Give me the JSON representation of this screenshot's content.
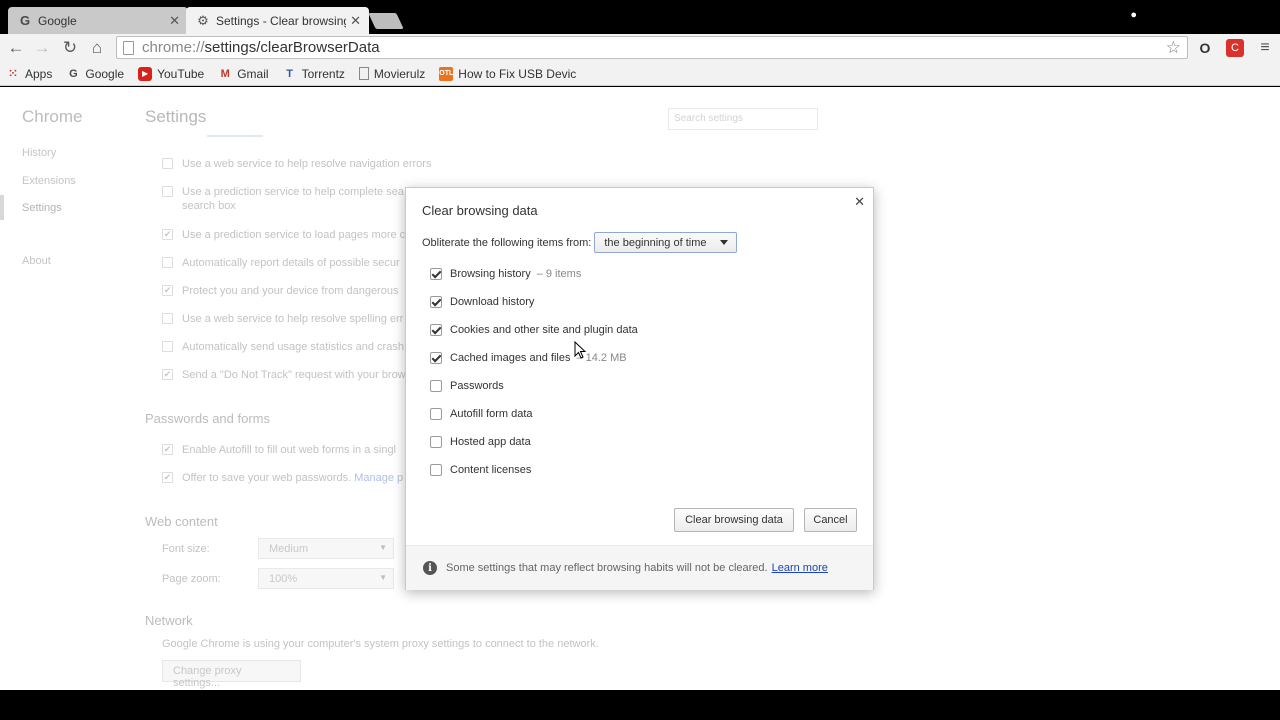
{
  "tabs": [
    {
      "title": "Google",
      "icon": "google-g-icon"
    },
    {
      "title": "Settings - Clear browsing",
      "icon": "gear-icon"
    }
  ],
  "omnibox": {
    "scheme": "chrome://",
    "path": "settings/clearBrowserData"
  },
  "bookmarks": [
    {
      "label": "Apps",
      "icon": "apps-grid-icon"
    },
    {
      "label": "Google",
      "icon": "google-g-icon"
    },
    {
      "label": "YouTube",
      "icon": "youtube-icon"
    },
    {
      "label": "Gmail",
      "icon": "gmail-icon"
    },
    {
      "label": "Torrentz",
      "icon": "torrentz-icon"
    },
    {
      "label": "Movierulz",
      "icon": "page-icon"
    },
    {
      "label": "How to Fix USB Devic",
      "icon": "otl-icon"
    }
  ],
  "settings": {
    "brand": "Chrome",
    "title": "Settings",
    "search_placeholder": "Search settings",
    "side_nav": [
      "History",
      "Extensions",
      "Settings",
      "About"
    ],
    "privacy_options": [
      {
        "label": "Use a web service to help resolve navigation errors",
        "checked": false
      },
      {
        "label": "Use a prediction service to help complete sea",
        "label2": "search box",
        "checked": false
      },
      {
        "label": "Use a prediction service to load pages more c",
        "checked": true
      },
      {
        "label": "Automatically report details of possible secur",
        "checked": false
      },
      {
        "label": "Protect you and your device from dangerous",
        "checked": true
      },
      {
        "label": "Use a web service to help resolve spelling err",
        "checked": false
      },
      {
        "label": "Automatically send usage statistics and crash",
        "checked": false
      },
      {
        "label": "Send a \"Do Not Track\" request with your brow",
        "checked": true
      }
    ],
    "passwords_head": "Passwords and forms",
    "passwords_options": [
      {
        "label": "Enable Autofill to fill out web forms in a singl",
        "checked": true
      },
      {
        "label": "Offer to save your web passwords.",
        "link": "Manage p",
        "checked": true
      }
    ],
    "web_content_head": "Web content",
    "font_size_label": "Font size:",
    "font_size_value": "Medium",
    "page_zoom_label": "Page zoom:",
    "page_zoom_value": "100%",
    "network_head": "Network",
    "proxy_text": "Google Chrome is using your computer's system proxy settings to connect to the network.",
    "proxy_button": "Change proxy settings..."
  },
  "dialog": {
    "title": "Clear browsing data",
    "range_label": "Obliterate the following items from:",
    "range_value": "the beginning of time",
    "items": [
      {
        "label": "Browsing history",
        "meta": "– 9 items",
        "checked": true
      },
      {
        "label": "Download history",
        "meta": "",
        "checked": true
      },
      {
        "label": "Cookies and other site and plugin data",
        "meta": "",
        "checked": true
      },
      {
        "label": "Cached images and files",
        "meta": "– 14.2 MB",
        "checked": true
      },
      {
        "label": "Passwords",
        "meta": "",
        "checked": false
      },
      {
        "label": "Autofill form data",
        "meta": "",
        "checked": false
      },
      {
        "label": "Hosted app data",
        "meta": "",
        "checked": false
      },
      {
        "label": "Content licenses",
        "meta": "",
        "checked": false
      }
    ],
    "clear_button": "Clear browsing data",
    "cancel_button": "Cancel",
    "footer_text": "Some settings that may reflect browsing habits will not be cleared.",
    "learn_more": "Learn more"
  }
}
